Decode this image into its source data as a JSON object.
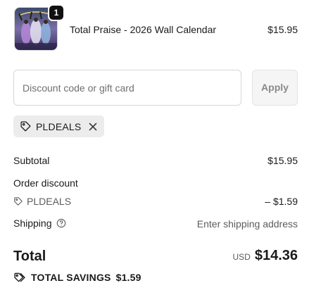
{
  "product": {
    "quantity": "1",
    "title": "Total Praise - 2026 Wall Calendar",
    "price": "$15.95",
    "image_icon": "calendar-cover-image"
  },
  "discount": {
    "placeholder": "Discount code or gift card",
    "value": "",
    "apply_label": "Apply",
    "applied_code": "PLDEALS",
    "tag_icon": "tag-icon",
    "remove_icon": "close-icon"
  },
  "summary": {
    "subtotal_label": "Subtotal",
    "subtotal_value": "$15.95",
    "order_discount_label": "Order discount",
    "discount_code": "PLDEALS",
    "discount_value": "– $1.59",
    "shipping_label": "Shipping",
    "shipping_value": "Enter shipping address",
    "help_icon": "help-circle-icon"
  },
  "total": {
    "label": "Total",
    "currency": "USD",
    "amount": "$14.36"
  },
  "savings": {
    "label": "TOTAL SAVINGS",
    "amount": "$1.59",
    "icon": "tags-icon"
  },
  "colors": {
    "text": "#1a1a1a",
    "muted": "#5c5c5c",
    "border": "#d6d6d6",
    "chip_bg": "#ececec",
    "apply_bg": "#f5f5f5",
    "badge_bg": "#111111"
  }
}
